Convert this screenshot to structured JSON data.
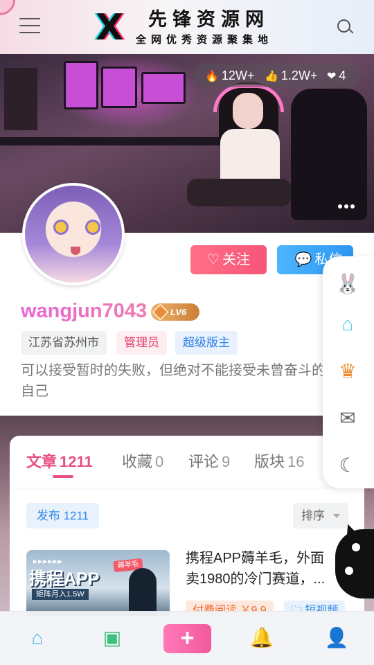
{
  "header": {
    "logo_letter": "X",
    "logo_title": "先锋资源网",
    "logo_subtitle": "全网优秀资源聚集地",
    "menu_icon": "hamburger-menu-icon",
    "search_icon": "search-icon"
  },
  "banner": {
    "stats": [
      {
        "icon": "fire-icon",
        "value": "12W+"
      },
      {
        "icon": "thumbs-up-icon",
        "value": "1.2W+"
      },
      {
        "icon": "heart-icon",
        "value": "4"
      }
    ],
    "more_icon": "more-dots-icon"
  },
  "profile": {
    "username": "wangjun7043",
    "level": "LV6",
    "follow_label": "关注",
    "message_label": "私信",
    "tags": [
      "江苏省苏州市",
      "管理员",
      "超级版主"
    ],
    "bio": "可以接受暂时的失败，但绝对不能接受未曾奋斗的自己"
  },
  "tabs": [
    {
      "label": "文章",
      "count": "1211"
    },
    {
      "label": "收藏",
      "count": "0"
    },
    {
      "label": "评论",
      "count": "9"
    },
    {
      "label": "版块",
      "count": "16"
    }
  ],
  "toolbar": {
    "publish_label": "发布 1211",
    "sort_label": "排序"
  },
  "post": {
    "thumb_title": "携程APP",
    "thumb_subtitle": "矩阵月入1.5W",
    "thumb_badge": "薅羊毛",
    "title_line1": "携程APP薅羊毛，外面",
    "title_line2": "卖1980的冷门赛道，...",
    "tag1": "付费阅读 ￥9.9",
    "tag2": "短视频"
  },
  "side_menu": [
    "gift-heart-icon",
    "home-icon",
    "crown-icon",
    "wechat-icon",
    "moon-icon"
  ],
  "bottom_nav": [
    "home-icon",
    "wallet-icon",
    "add-icon",
    "bell-icon",
    "user-icon"
  ],
  "colors": {
    "accent_pink": "#e84f82",
    "username_gradient_start": "#e965d6",
    "follow_button": "#f8557a",
    "message_button": "#2f96f0"
  }
}
